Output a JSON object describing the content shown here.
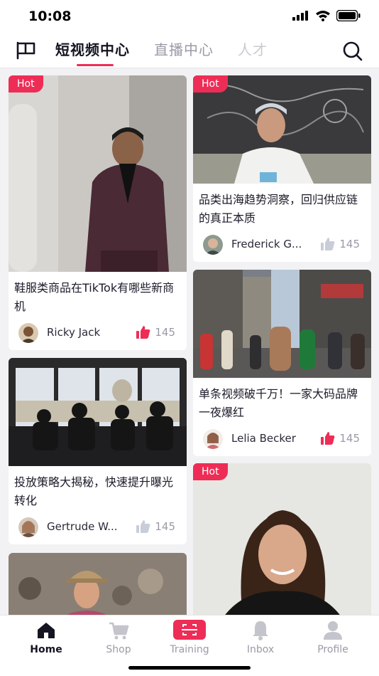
{
  "status": {
    "time": "10:08"
  },
  "nav": {
    "tabs": [
      "短视频中心",
      "直播中心",
      "人才"
    ],
    "active_tab": 0
  },
  "cards": [
    {
      "hot": "Hot",
      "title": "鞋服类商品在TikTok有哪些新商机",
      "author": "Ricky Jack",
      "likes": "145"
    },
    {
      "hot": "Hot",
      "title": "品类出海趋势洞察，回归供应链的真正本质",
      "author": "Frederick G...",
      "likes": "145"
    },
    {
      "hot": "",
      "title": "投放策略大揭秘，快速提升曝光转化",
      "author": "Gertrude W...",
      "likes": "145"
    },
    {
      "hot": "",
      "title": "单条视频破千万！一家大码品牌一夜爆红",
      "author": "Lelia Becker",
      "likes": "145"
    },
    {
      "hot": "",
      "title": "",
      "author": "",
      "likes": ""
    },
    {
      "hot": "Hot",
      "title": "",
      "author": "",
      "likes": ""
    }
  ],
  "bottom_nav": [
    "Home",
    "Shop",
    "Training",
    "Inbox",
    "Profile"
  ],
  "colors": {
    "accent": "#ee2d56",
    "inactive": "#c4c4cc",
    "dark": "#141422"
  },
  "icons": [
    "flag-icon",
    "search-icon",
    "thumb-up-icon",
    "home-icon",
    "cart-icon",
    "scan-icon",
    "bell-icon",
    "person-icon"
  ]
}
